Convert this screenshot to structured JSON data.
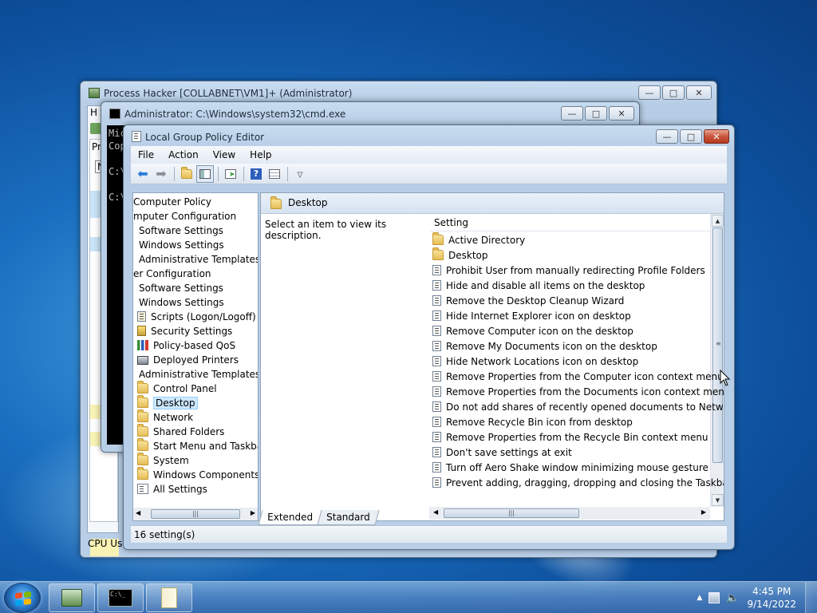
{
  "process_hacker": {
    "title": "Process Hacker [COLLABNET\\VM1]+ (Administrator)",
    "partial_tab": "H",
    "partial_left1": "Pr",
    "partial_left2": "N",
    "status_partial": "CPU Usa"
  },
  "cmd": {
    "title": "Administrator: C:\\Windows\\system32\\cmd.exe",
    "lines": [
      "Mic",
      "Cop",
      "",
      "C:\\",
      "",
      "C:\\"
    ]
  },
  "gpedit": {
    "title": "Local Group Policy Editor",
    "menu": [
      "File",
      "Action",
      "View",
      "Help"
    ],
    "tree": [
      {
        "label": "Computer Policy",
        "indent": 0,
        "icon": "none"
      },
      {
        "label": "mputer Configuration",
        "indent": 0,
        "icon": "none"
      },
      {
        "label": "Software Settings",
        "indent": 1,
        "icon": "none"
      },
      {
        "label": "Windows Settings",
        "indent": 1,
        "icon": "none"
      },
      {
        "label": "Administrative Templates",
        "indent": 1,
        "icon": "none"
      },
      {
        "label": "er Configuration",
        "indent": 0,
        "icon": "none"
      },
      {
        "label": "Software Settings",
        "indent": 1,
        "icon": "none"
      },
      {
        "label": "Windows Settings",
        "indent": 1,
        "icon": "none"
      },
      {
        "label": "Scripts (Logon/Logoff)",
        "indent": 2,
        "icon": "script-icon"
      },
      {
        "label": "Security Settings",
        "indent": 2,
        "icon": "security-icon"
      },
      {
        "label": "Policy-based QoS",
        "indent": 2,
        "icon": "chart-icon"
      },
      {
        "label": "Deployed Printers",
        "indent": 2,
        "icon": "printer-icon"
      },
      {
        "label": "Administrative Templates",
        "indent": 1,
        "icon": "none"
      },
      {
        "label": "Control Panel",
        "indent": 2,
        "icon": "folder-icon"
      },
      {
        "label": "Desktop",
        "indent": 2,
        "icon": "folder-icon",
        "selected": true
      },
      {
        "label": "Network",
        "indent": 2,
        "icon": "folder-icon"
      },
      {
        "label": "Shared Folders",
        "indent": 2,
        "icon": "folder-icon"
      },
      {
        "label": "Start Menu and Taskbar",
        "indent": 2,
        "icon": "folder-icon"
      },
      {
        "label": "System",
        "indent": 2,
        "icon": "folder-icon"
      },
      {
        "label": "Windows Components",
        "indent": 2,
        "icon": "folder-icon"
      },
      {
        "label": "All Settings",
        "indent": 2,
        "icon": "all-settings-icon"
      }
    ],
    "header_title": "Desktop",
    "description": "Select an item to view its description.",
    "column_setting": "Setting",
    "settings": [
      {
        "label": "Active Directory",
        "icon": "folder-icon"
      },
      {
        "label": "Desktop",
        "icon": "folder-icon"
      },
      {
        "label": "Prohibit User from manually redirecting Profile Folders",
        "icon": "policy-icon"
      },
      {
        "label": "Hide and disable all items on the desktop",
        "icon": "policy-icon"
      },
      {
        "label": "Remove the Desktop Cleanup Wizard",
        "icon": "policy-icon"
      },
      {
        "label": "Hide Internet Explorer icon on desktop",
        "icon": "policy-icon"
      },
      {
        "label": "Remove Computer icon on the desktop",
        "icon": "policy-icon"
      },
      {
        "label": "Remove My Documents icon on the desktop",
        "icon": "policy-icon"
      },
      {
        "label": "Hide Network Locations icon on desktop",
        "icon": "policy-icon"
      },
      {
        "label": "Remove Properties from the Computer icon context menu",
        "icon": "policy-icon"
      },
      {
        "label": "Remove Properties from the Documents icon context menu",
        "icon": "policy-icon"
      },
      {
        "label": "Do not add shares of recently opened documents to Networ...",
        "icon": "policy-icon"
      },
      {
        "label": "Remove Recycle Bin icon from desktop",
        "icon": "policy-icon"
      },
      {
        "label": "Remove Properties from the Recycle Bin context menu",
        "icon": "policy-icon"
      },
      {
        "label": "Don't save settings at exit",
        "icon": "policy-icon"
      },
      {
        "label": "Turn off Aero Shake window minimizing mouse gesture",
        "icon": "policy-icon"
      },
      {
        "label": "Prevent adding, dragging, dropping and closing the Taskbar...",
        "icon": "policy-icon"
      }
    ],
    "tabs": [
      "Extended",
      "Standard"
    ],
    "status": "16 setting(s)"
  },
  "taskbar": {
    "time": "4:45 PM",
    "date": "9/14/2022"
  }
}
